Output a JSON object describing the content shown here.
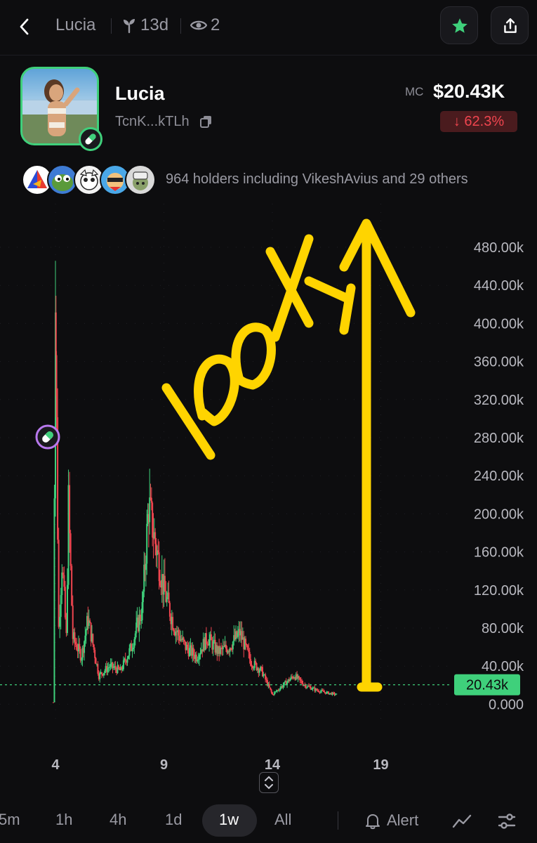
{
  "header": {
    "age": "13d",
    "watchers": "2",
    "colors": {
      "favorite_star": "#3fd07b"
    }
  },
  "title": "Lucia",
  "token": {
    "name": "Lucia",
    "address": "TcnK...kTLh",
    "mc_label": "MC",
    "mc_value": "$20.43K",
    "change": "↓ 62.3%"
  },
  "holders": {
    "text": "964 holders including VikeshAvius and 29 others"
  },
  "chart_data": {
    "type": "candlestick",
    "y_ticks": [
      "480.00k",
      "440.00k",
      "400.00k",
      "360.00k",
      "320.00k",
      "280.00k",
      "240.00k",
      "200.00k",
      "160.00k",
      "120.00k",
      "80.00k",
      "40.00k",
      "0.000"
    ],
    "x_ticks": [
      "4",
      "9",
      "14",
      "19"
    ],
    "current_price_label": "20.43k",
    "current_price": 20430,
    "ylim": [
      0,
      500000
    ],
    "grid": true,
    "annotation": "100X",
    "colors": {
      "up": "#3fd07b",
      "down": "#f0454f",
      "annotation": "#ffd400"
    },
    "series": [
      {
        "x": 3.9,
        "v": 2000
      },
      {
        "x": 4.0,
        "v": 460000
      },
      {
        "x": 4.05,
        "v": 290000
      },
      {
        "x": 4.15,
        "v": 80000
      },
      {
        "x": 4.3,
        "v": 150000
      },
      {
        "x": 4.5,
        "v": 70000
      },
      {
        "x": 4.6,
        "v": 210000
      },
      {
        "x": 4.8,
        "v": 70000
      },
      {
        "x": 5.2,
        "v": 50000
      },
      {
        "x": 5.5,
        "v": 90000
      },
      {
        "x": 6.0,
        "v": 30000
      },
      {
        "x": 6.5,
        "v": 40000
      },
      {
        "x": 7.0,
        "v": 35000
      },
      {
        "x": 7.5,
        "v": 60000
      },
      {
        "x": 8.0,
        "v": 100000
      },
      {
        "x": 8.3,
        "v": 210000
      },
      {
        "x": 8.6,
        "v": 170000
      },
      {
        "x": 9.0,
        "v": 120000
      },
      {
        "x": 9.5,
        "v": 80000
      },
      {
        "x": 10.0,
        "v": 60000
      },
      {
        "x": 10.5,
        "v": 50000
      },
      {
        "x": 11.0,
        "v": 70000
      },
      {
        "x": 11.5,
        "v": 55000
      },
      {
        "x": 12.0,
        "v": 60000
      },
      {
        "x": 12.5,
        "v": 75000
      },
      {
        "x": 13.0,
        "v": 45000
      },
      {
        "x": 13.5,
        "v": 35000
      },
      {
        "x": 14.0,
        "v": 10000
      },
      {
        "x": 14.5,
        "v": 20000
      },
      {
        "x": 15.0,
        "v": 30000
      },
      {
        "x": 15.5,
        "v": 20000
      },
      {
        "x": 16.0,
        "v": 15000
      },
      {
        "x": 16.5,
        "v": 12000
      },
      {
        "x": 17.0,
        "v": 10000
      }
    ]
  },
  "timeframes": [
    "5m",
    "1h",
    "4h",
    "1d",
    "1w",
    "All"
  ],
  "alert_label": "Alert"
}
